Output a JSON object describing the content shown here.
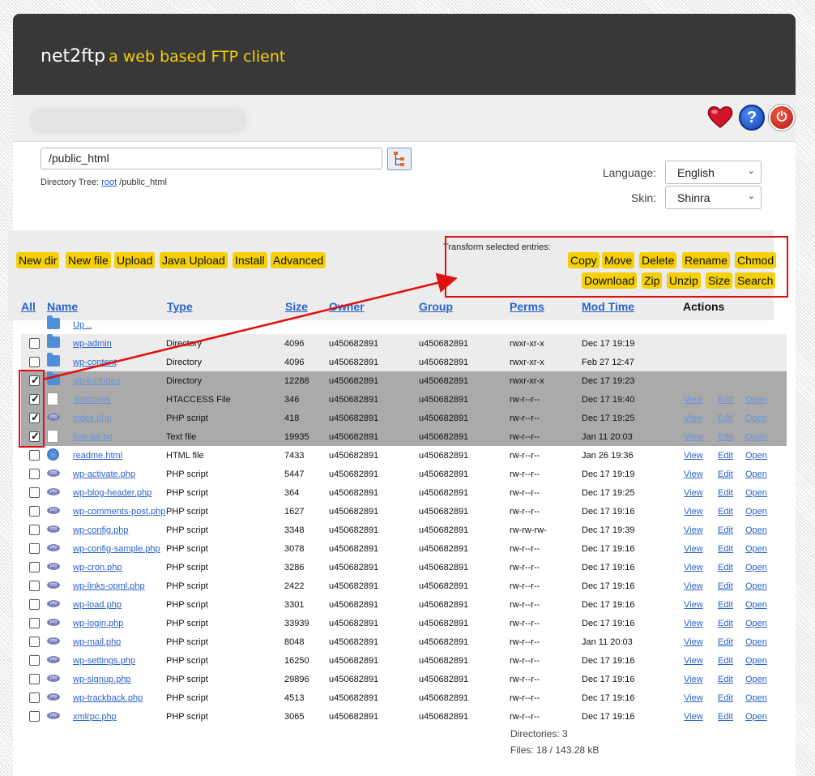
{
  "header": {
    "app_name": "net2ftp",
    "tagline": "a web based FTP client"
  },
  "icons": {
    "heart": "heart-icon",
    "help": "help-icon",
    "logout": "power-icon"
  },
  "directory": {
    "path": "/public_html",
    "tree_label": "Directory Tree:",
    "tree_root": "root",
    "tree_rest": "/public_html"
  },
  "settings": {
    "language_label": "Language:",
    "language_value": "English",
    "skin_label": "Skin:",
    "skin_value": "Shinra"
  },
  "toolbar": {
    "left_buttons": [
      "New dir",
      "New file",
      "Upload",
      "Java Upload",
      "Install",
      "Advanced"
    ],
    "transform_label": "Transform selected entries:",
    "transform_row1": [
      "Copy",
      "Move",
      "Delete",
      "Rename",
      "Chmod"
    ],
    "transform_row2": [
      "Download",
      "Zip",
      "Unzip",
      "Size",
      "Search"
    ]
  },
  "columns": {
    "all": "All",
    "name": "Name",
    "type": "Type",
    "size": "Size",
    "owner": "Owner",
    "group": "Group",
    "perms": "Perms",
    "mod_time": "Mod Time",
    "actions": "Actions"
  },
  "up_label": "Up ..",
  "actions": {
    "view": "View",
    "edit": "Edit",
    "open": "Open"
  },
  "files": [
    {
      "name": "wp-admin",
      "type": "Directory",
      "size": "4096",
      "owner": "u450682891",
      "group": "u450682891",
      "perms": "rwxr-xr-x",
      "mtime": "Dec 17 19:19",
      "icon": "folder",
      "checked": false,
      "actions": false
    },
    {
      "name": "wp-content",
      "type": "Directory",
      "size": "4096",
      "owner": "u450682891",
      "group": "u450682891",
      "perms": "rwxr-xr-x",
      "mtime": "Feb 27 12:47",
      "icon": "folder",
      "checked": false,
      "actions": false
    },
    {
      "name": "wp-includes",
      "type": "Directory",
      "size": "12288",
      "owner": "u450682891",
      "group": "u450682891",
      "perms": "rwxr-xr-x",
      "mtime": "Dec 17 19:23",
      "icon": "folder",
      "checked": true,
      "actions": false
    },
    {
      "name": ".htaccess",
      "type": "HTACCESS File",
      "size": "346",
      "owner": "u450682891",
      "group": "u450682891",
      "perms": "rw-r--r--",
      "mtime": "Dec 17 19:40",
      "icon": "txt",
      "checked": true,
      "actions": true
    },
    {
      "name": "index.php",
      "type": "PHP script",
      "size": "418",
      "owner": "u450682891",
      "group": "u450682891",
      "perms": "rw-r--r--",
      "mtime": "Dec 17 19:25",
      "icon": "php",
      "checked": true,
      "actions": true
    },
    {
      "name": "license.txt",
      "type": "Text file",
      "size": "19935",
      "owner": "u450682891",
      "group": "u450682891",
      "perms": "rw-r--r--",
      "mtime": "Jan 11 20:03",
      "icon": "txt",
      "checked": true,
      "actions": true
    },
    {
      "name": "readme.html",
      "type": "HTML file",
      "size": "7433",
      "owner": "u450682891",
      "group": "u450682891",
      "perms": "rw-r--r--",
      "mtime": "Jan 26 19:36",
      "icon": "html",
      "checked": false,
      "actions": true
    },
    {
      "name": "wp-activate.php",
      "type": "PHP script",
      "size": "5447",
      "owner": "u450682891",
      "group": "u450682891",
      "perms": "rw-r--r--",
      "mtime": "Dec 17 19:19",
      "icon": "php",
      "checked": false,
      "actions": true
    },
    {
      "name": "wp-blog-header.php",
      "type": "PHP script",
      "size": "364",
      "owner": "u450682891",
      "group": "u450682891",
      "perms": "rw-r--r--",
      "mtime": "Dec 17 19:25",
      "icon": "php",
      "checked": false,
      "actions": true
    },
    {
      "name": "wp-comments-post.php",
      "type": "PHP script",
      "size": "1627",
      "owner": "u450682891",
      "group": "u450682891",
      "perms": "rw-r--r--",
      "mtime": "Dec 17 19:16",
      "icon": "php",
      "checked": false,
      "actions": true
    },
    {
      "name": "wp-config.php",
      "type": "PHP script",
      "size": "3348",
      "owner": "u450682891",
      "group": "u450682891",
      "perms": "rw-rw-rw-",
      "mtime": "Dec 17 19:39",
      "icon": "php",
      "checked": false,
      "actions": true
    },
    {
      "name": "wp-config-sample.php",
      "type": "PHP script",
      "size": "3078",
      "owner": "u450682891",
      "group": "u450682891",
      "perms": "rw-r--r--",
      "mtime": "Dec 17 19:16",
      "icon": "php",
      "checked": false,
      "actions": true
    },
    {
      "name": "wp-cron.php",
      "type": "PHP script",
      "size": "3286",
      "owner": "u450682891",
      "group": "u450682891",
      "perms": "rw-r--r--",
      "mtime": "Dec 17 19:16",
      "icon": "php",
      "checked": false,
      "actions": true
    },
    {
      "name": "wp-links-opml.php",
      "type": "PHP script",
      "size": "2422",
      "owner": "u450682891",
      "group": "u450682891",
      "perms": "rw-r--r--",
      "mtime": "Dec 17 19:16",
      "icon": "php",
      "checked": false,
      "actions": true
    },
    {
      "name": "wp-load.php",
      "type": "PHP script",
      "size": "3301",
      "owner": "u450682891",
      "group": "u450682891",
      "perms": "rw-r--r--",
      "mtime": "Dec 17 19:16",
      "icon": "php",
      "checked": false,
      "actions": true
    },
    {
      "name": "wp-login.php",
      "type": "PHP script",
      "size": "33939",
      "owner": "u450682891",
      "group": "u450682891",
      "perms": "rw-r--r--",
      "mtime": "Dec 17 19:16",
      "icon": "php",
      "checked": false,
      "actions": true
    },
    {
      "name": "wp-mail.php",
      "type": "PHP script",
      "size": "8048",
      "owner": "u450682891",
      "group": "u450682891",
      "perms": "rw-r--r--",
      "mtime": "Jan 11 20:03",
      "icon": "php",
      "checked": false,
      "actions": true
    },
    {
      "name": "wp-settings.php",
      "type": "PHP script",
      "size": "16250",
      "owner": "u450682891",
      "group": "u450682891",
      "perms": "rw-r--r--",
      "mtime": "Dec 17 19:16",
      "icon": "php",
      "checked": false,
      "actions": true
    },
    {
      "name": "wp-signup.php",
      "type": "PHP script",
      "size": "29896",
      "owner": "u450682891",
      "group": "u450682891",
      "perms": "rw-r--r--",
      "mtime": "Dec 17 19:16",
      "icon": "php",
      "checked": false,
      "actions": true
    },
    {
      "name": "wp-trackback.php",
      "type": "PHP script",
      "size": "4513",
      "owner": "u450682891",
      "group": "u450682891",
      "perms": "rw-r--r--",
      "mtime": "Dec 17 19:16",
      "icon": "php",
      "checked": false,
      "actions": true
    },
    {
      "name": "xmlrpc.php",
      "type": "PHP script",
      "size": "3065",
      "owner": "u450682891",
      "group": "u450682891",
      "perms": "rw-r--r--",
      "mtime": "Dec 17 19:16",
      "icon": "php",
      "checked": false,
      "actions": true
    }
  ],
  "summary": {
    "directories": "Directories: 3",
    "files": "Files: 18 / 143.28 kB"
  },
  "colors": {
    "header_bg": "#383838",
    "accent_yellow": "#f5cf08",
    "link_blue": "#2a62c9",
    "highlight_red": "#e01010",
    "selected_row": "#aaaaaa"
  }
}
